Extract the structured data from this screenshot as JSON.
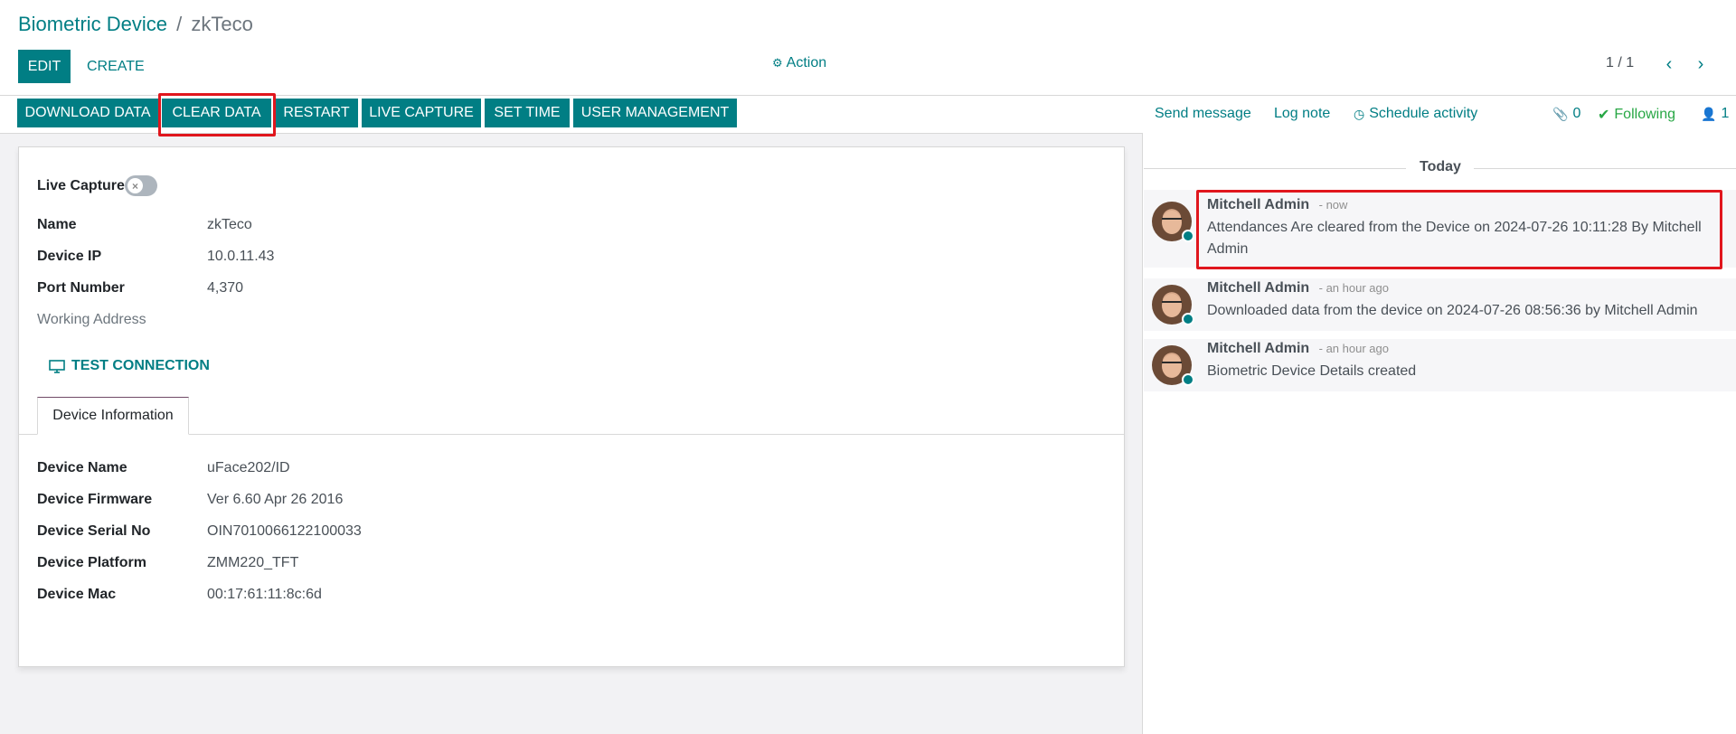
{
  "breadcrumb": {
    "parent": "Biometric Device",
    "separator": "/",
    "current": "zkTeco"
  },
  "control": {
    "edit_label": "EDIT",
    "create_label": "CREATE",
    "action_label": "Action",
    "pager": "1 / 1"
  },
  "statusbar": {
    "buttons": [
      "DOWNLOAD DATA",
      "CLEAR DATA",
      "RESTART",
      "LIVE CAPTURE",
      "SET TIME",
      "USER MANAGEMENT"
    ]
  },
  "form": {
    "live_capture_label": "Live Capture",
    "live_capture_on": false,
    "name_label": "Name",
    "name_value": "zkTeco",
    "ip_label": "Device IP",
    "ip_value": "10.0.11.43",
    "port_label": "Port Number",
    "port_value": "4,370",
    "address_label": "Working Address",
    "test_connection_label": "TEST CONNECTION",
    "tab_label": "Device Information",
    "device_name_label": "Device Name",
    "device_name_value": "uFace202/ID",
    "firmware_label": "Device Firmware",
    "firmware_value": "Ver 6.60 Apr 26 2016",
    "serial_label": "Device Serial No",
    "serial_value": "OIN7010066122100033",
    "platform_label": "Device Platform",
    "platform_value": "ZMM220_TFT",
    "mac_label": "Device Mac",
    "mac_value": "00:17:61:11:8c:6d"
  },
  "chatter": {
    "send_message": "Send message",
    "log_note": "Log note",
    "schedule_activity": "Schedule activity",
    "attachments_count": "0",
    "following_label": "Following",
    "followers_count": "1",
    "today_label": "Today",
    "messages": [
      {
        "author": "Mitchell Admin",
        "date": "- now",
        "body": "Attendances Are cleared from the Device on 2024-07-26 10:11:28 By Mitchell Admin"
      },
      {
        "author": "Mitchell Admin",
        "date": "- an hour ago",
        "body": "Downloaded data from the device on 2024-07-26 08:56:36 by Mitchell Admin"
      },
      {
        "author": "Mitchell Admin",
        "date": "- an hour ago",
        "body": "Biometric Device Details created"
      }
    ]
  },
  "colors": {
    "primary": "#017e84",
    "highlight": "#e0161d",
    "following": "#28a745"
  }
}
